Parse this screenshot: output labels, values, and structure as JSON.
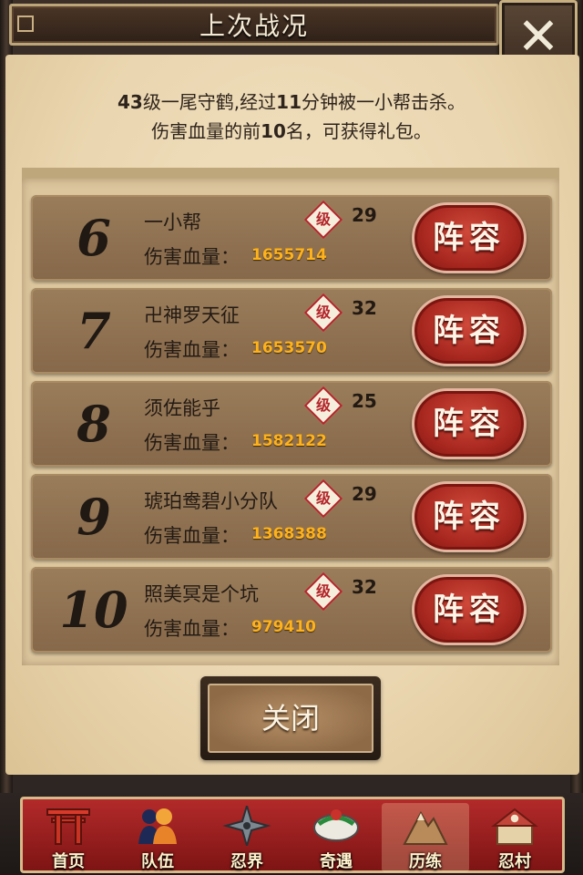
{
  "header": {
    "title": "上次战况",
    "close_icon": "close-icon"
  },
  "intro": {
    "line1_level": "43",
    "line1_a": "级一尾守鹤,经过",
    "line1_minutes": "11",
    "line1_b": "分钟被一小帮击杀。",
    "line2_a": "伤害血量的前",
    "line2_count": "10",
    "line2_b": "名，可获得礼包。"
  },
  "rank_list": [
    {
      "rank": "6",
      "name": "一小帮",
      "level_badge": "级",
      "level": "29",
      "damage_label": "伤害血量：",
      "damage": "1655714",
      "button": "阵容"
    },
    {
      "rank": "7",
      "name": "卍神罗天征",
      "level_badge": "级",
      "level": "32",
      "damage_label": "伤害血量：",
      "damage": "1653570",
      "button": "阵容"
    },
    {
      "rank": "8",
      "name": "须佐能乎",
      "level_badge": "级",
      "level": "25",
      "damage_label": "伤害血量：",
      "damage": "1582122",
      "button": "阵容"
    },
    {
      "rank": "9",
      "name": "琥珀鸯碧小分队",
      "level_badge": "级",
      "level": "29",
      "damage_label": "伤害血量：",
      "damage": "1368388",
      "button": "阵容"
    },
    {
      "rank": "10",
      "name": "照美冥是个坑",
      "level_badge": "级",
      "level": "32",
      "damage_label": "伤害血量：",
      "damage": "979410",
      "button": "阵容"
    }
  ],
  "footer": {
    "close_label": "关闭"
  },
  "nav": [
    {
      "label": "首页",
      "icon": "torii-gate-icon",
      "active": false
    },
    {
      "label": "队伍",
      "icon": "team-icon",
      "active": false
    },
    {
      "label": "忍界",
      "icon": "shuriken-icon",
      "active": false
    },
    {
      "label": "奇遇",
      "icon": "scroll-icon",
      "active": false
    },
    {
      "label": "历练",
      "icon": "mountain-icon",
      "active": true
    },
    {
      "label": "忍村",
      "icon": "village-icon",
      "active": false
    }
  ],
  "colors": {
    "accent_red": "#b3242a",
    "damage_orange": "#ffb21a",
    "parchment": "#ead6b0"
  }
}
